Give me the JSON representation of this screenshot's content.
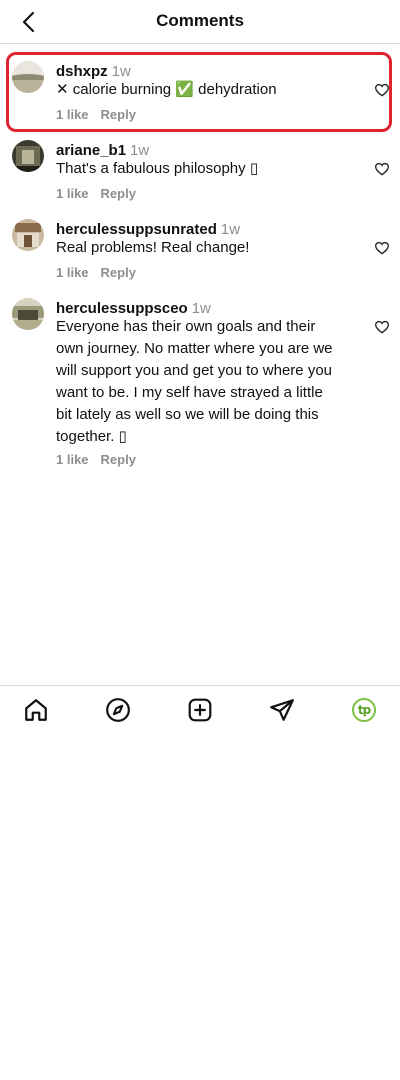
{
  "header": {
    "title": "Comments"
  },
  "comments": [
    {
      "username": "dshxpz",
      "time": "1w",
      "text": "✕ calorie burning ✅ dehydration",
      "likes": "1 like",
      "reply": "Reply",
      "highlighted": true
    },
    {
      "username": "ariane_b1",
      "time": "1w",
      "text": "That's a fabulous philosophy ▯",
      "likes": "1 like",
      "reply": "Reply"
    },
    {
      "username": "herculessuppsunrated",
      "time": "1w",
      "text": "Real problems! Real change!",
      "likes": "1 like",
      "reply": "Reply"
    },
    {
      "username": "herculessuppsceo",
      "time": "1w",
      "text": "Everyone has their own goals and their own journey. No matter where you are we will support you and get you to where you want to be. I my self have strayed a little bit lately as well so we will be doing this together. ▯",
      "likes": "1 like",
      "reply": "Reply"
    }
  ],
  "nav": {
    "items": [
      "home-icon",
      "explore-icon",
      "create-icon",
      "direct-message-icon",
      "profile-icon"
    ],
    "profile_initials": "tp"
  },
  "colors": {
    "highlight": "#e0242f",
    "profile_ring": "#7ac142",
    "muted": "#8e8e8e"
  }
}
